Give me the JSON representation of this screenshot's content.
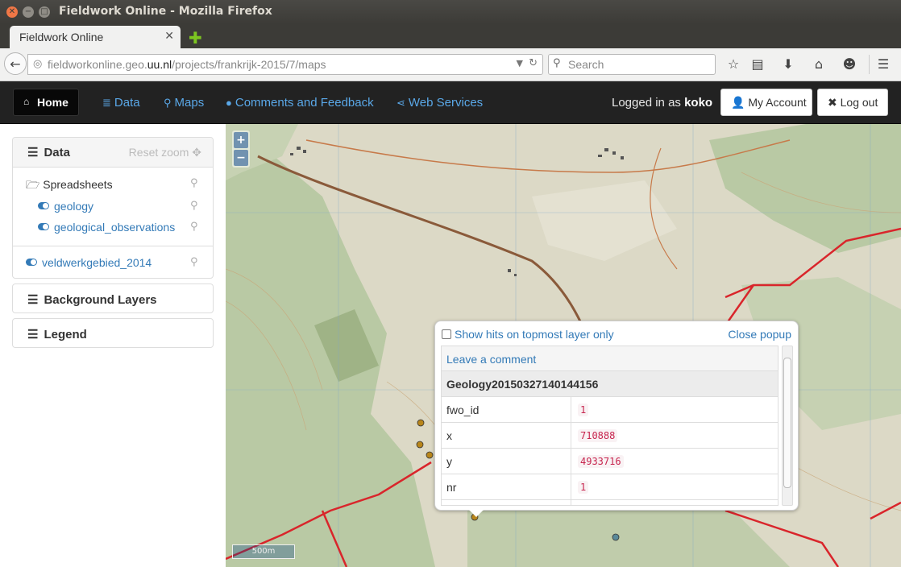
{
  "window": {
    "title": "Fieldwork Online - Mozilla Firefox"
  },
  "browser": {
    "tab_label": "Fieldwork Online",
    "url_host_prefix": "fieldworkonline.geo.",
    "url_host_domain": "uu.nl",
    "url_path": "/projects/frankrijk-2015/7/maps",
    "search_placeholder": "Search"
  },
  "nav": {
    "home_label": "Home",
    "links": [
      "Data",
      "Maps",
      "Comments and Feedback",
      "Web Services"
    ],
    "logged_in_prefix": "Logged in as",
    "username": "koko",
    "my_account_label": "My Account",
    "logout_label": "Log out"
  },
  "sidebar": {
    "data_title": "Data",
    "reset_zoom_label": "Reset zoom",
    "folder_label": "Spreadsheets",
    "layers": [
      "geology",
      "geological_observations"
    ],
    "extra_layer": "veldwerkgebied_2014",
    "background_title": "Background Layers",
    "legend_title": "Legend"
  },
  "map": {
    "zoom_in": "+",
    "zoom_out": "−",
    "scale_label": "500m"
  },
  "popup": {
    "show_hits_label": "Show hits on topmost layer only",
    "close_label": "Close popup",
    "leave_comment": "Leave a comment",
    "record_title": "Geology20150327140144156",
    "rows": [
      {
        "key": "fwo_id",
        "value": "1"
      },
      {
        "key": "x",
        "value": "710888"
      },
      {
        "key": "y",
        "value": "4933716"
      },
      {
        "key": "nr",
        "value": "1"
      }
    ]
  },
  "colors": {
    "navbar_bg": "#222222",
    "link_blue": "#337ab7",
    "nav_link_blue": "#5aa8e8",
    "boundary_red": "#d9252b"
  }
}
